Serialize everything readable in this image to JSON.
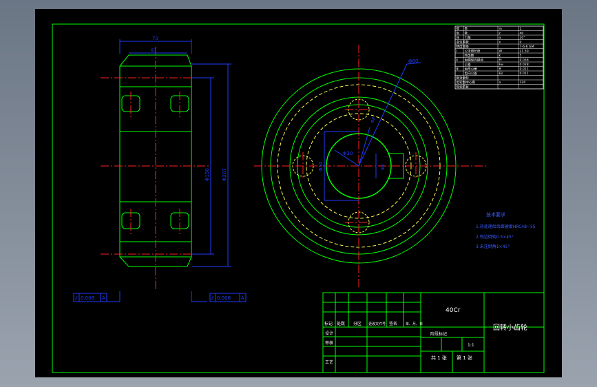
{
  "colors": {
    "background": "#000000",
    "frame": "#00ff00",
    "center_line": "#ff2020",
    "hidden_line": "#ffff55",
    "dimension": "#1f3cff",
    "text": "#ffffff",
    "annotation": "#3d5cff"
  },
  "side_view": {
    "dim_width": "70",
    "dim_inner": "60",
    "dim_bore": "Φ150",
    "dim_outer": "Φ207"
  },
  "front_view": {
    "dim_outer": "Φ80",
    "dim_pcd": "Φ50",
    "dim_bore": "Φ30",
    "dim_hole": "Φ8",
    "dim_key": "Φ8"
  },
  "tolerance_frames": [
    {
      "value": "0.008",
      "datum": "A"
    },
    {
      "value": "0.008",
      "datum": "A"
    }
  ],
  "tech_requirements": {
    "title": "技术要求",
    "items": [
      "1.热处理后齿面硬度HRC48~55",
      "2.锐边倒钝0.5×45°",
      "3.未注倒角1×45°"
    ]
  },
  "param_table": {
    "rows": [
      {
        "c1": "模",
        "c2": "数",
        "c3": "m",
        "c4": "2"
      },
      {
        "c1": "齿",
        "c2": "数",
        "c3": "z",
        "c4": "40"
      },
      {
        "c1": "压",
        "c2": "力角",
        "c3": "α",
        "c4": "20°"
      },
      {
        "c1": "变位系数",
        "c2": "",
        "c3": "x",
        "c4": "0"
      },
      {
        "c1": "精度等级",
        "c2": "",
        "c3": "",
        "c4": "7-6-6 GM"
      },
      {
        "c1": "Ⅰ",
        "c2": "公法线长度",
        "c3": "W",
        "c4": "21.50"
      },
      {
        "c1": "",
        "c2": "跨齿数",
        "c3": "k",
        "c4": "5"
      },
      {
        "c1": "Ⅱ",
        "c2": "齿圈径向跳动",
        "c3": "Fr",
        "c4": "0.036"
      },
      {
        "c1": "",
        "c2": "公差",
        "c3": "Fw",
        "c4": "0.028"
      },
      {
        "c1": "Ⅲ",
        "c2": "齿形公差",
        "c3": "ff",
        "c4": "0.011"
      },
      {
        "c1": "",
        "c2": "齿向公差",
        "c3": "Fβ",
        "c4": "0.011"
      },
      {
        "c1": "配对齿轮",
        "c2": "",
        "c3": "",
        "c4": ""
      },
      {
        "c1": "齿轮副中心距",
        "c2": "",
        "c3": "a",
        "c4": "120"
      },
      {
        "c1": "检验项目",
        "c2": "",
        "c3": "",
        "c4": ""
      }
    ]
  },
  "title_block": {
    "material": "40Cr",
    "drawing_name": "回转小齿轮",
    "marks_label": "标记",
    "count_label": "处数",
    "zone_label": "分区",
    "change_doc_label": "更改文件号",
    "sign_label": "签名",
    "date_label": "年、月、日",
    "design_label": "设计",
    "check_label": "审核",
    "process_label": "工艺",
    "stage_label": "阶段标记",
    "scale_label": "1:1",
    "sheet_total": "共  1  张",
    "sheet_no": "第  1  张"
  }
}
